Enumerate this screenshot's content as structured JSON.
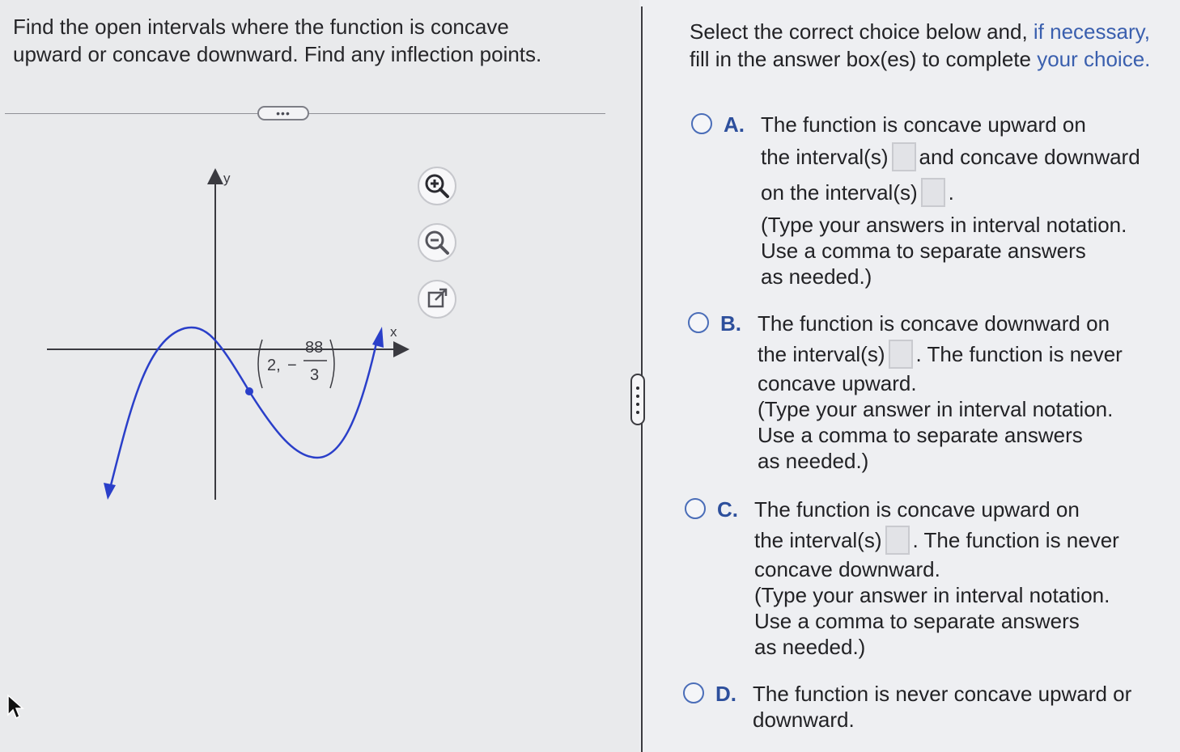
{
  "question": {
    "line1": "Find the open intervals where the function is concave",
    "line2": "upward or concave downward. Find any inflection points."
  },
  "toolbar": {
    "more_label": "•••"
  },
  "graph": {
    "x_axis_label": "x",
    "y_axis_label": "y",
    "point_x": "2,",
    "point_minus": "−",
    "point_numerator": "88",
    "point_denominator": "3",
    "curve_color": "#2a3fc9",
    "axis_color": "#3a3a40"
  },
  "tools": {
    "zoom_in": "zoom-in-icon",
    "zoom_out": "zoom-out-icon",
    "popout": "popout-icon"
  },
  "instructions": {
    "part1": "Select the correct choice below and, ",
    "part2": "if necessary,",
    "part3": "fill in the answer box(es) to complete ",
    "part4": "your choice."
  },
  "choices": {
    "a": {
      "letter": "A.",
      "l1": "The function is concave upward on",
      "l2a": "the interval(s)",
      "l2b": "and concave downward",
      "l3a": "on the interval(s)",
      "l3b": ".",
      "l4": "(Type your answers in interval notation.",
      "l5": "Use a comma to separate answers",
      "l6": "as needed.)"
    },
    "b": {
      "letter": "B.",
      "l1": "The function is concave downward on",
      "l2a": "the interval(s)",
      "l2b": ". The function is never",
      "l3": "concave upward.",
      "l4": "(Type your answer in interval notation.",
      "l5": "Use a comma to separate answers",
      "l6": "as needed.)"
    },
    "c": {
      "letter": "C.",
      "l1": "The function is concave upward on",
      "l2a": "the interval(s)",
      "l2b": ". The function is never",
      "l3": "concave downward.",
      "l4": "(Type your answer in interval notation.",
      "l5": "Use a comma to separate answers",
      "l6": "as needed.)"
    },
    "d": {
      "letter": "D.",
      "l1": "The function is never concave upward or",
      "l2": "downward."
    }
  },
  "colors": {
    "accent": "#2d4f9c",
    "link": "#3a5fae",
    "background": "#eceef1"
  }
}
